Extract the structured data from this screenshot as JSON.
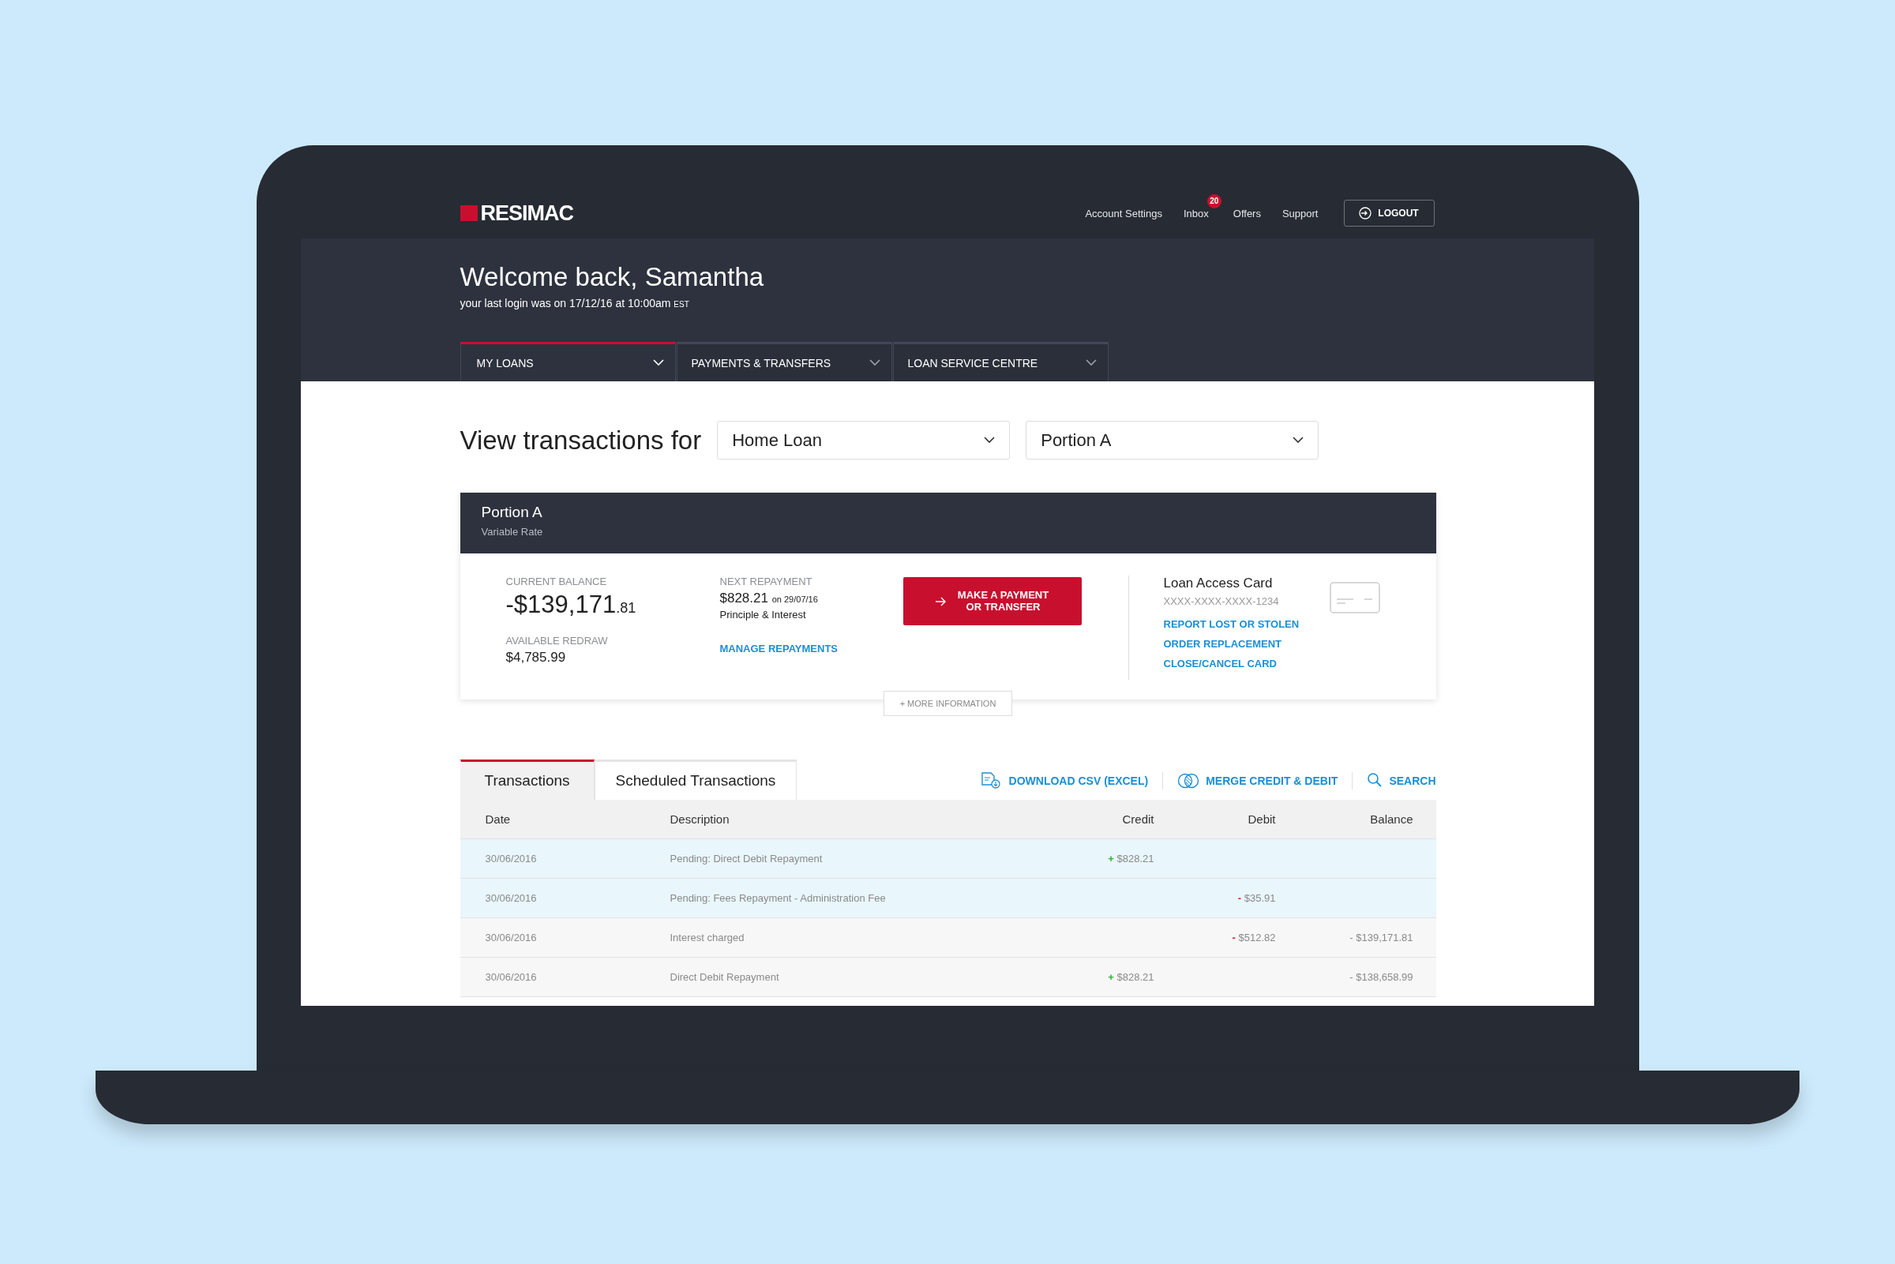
{
  "header": {
    "logo": "RESIMAC",
    "links": [
      {
        "label": "Account Settings"
      },
      {
        "label": "Inbox",
        "badge": "20"
      },
      {
        "label": "Offers"
      },
      {
        "label": "Support"
      }
    ],
    "logout": "LOGOUT"
  },
  "welcome": {
    "greeting": "Welcome back,",
    "name": "Samantha",
    "last_login": "your last login was on 17/12/16 at 10:00am",
    "timezone": "EST"
  },
  "nav_tabs": [
    {
      "label": "MY LOANS",
      "selected": true
    },
    {
      "label": "PAYMENTS & TRANSFERS",
      "selected": false
    },
    {
      "label": "LOAN SERVICE CENTRE",
      "selected": false
    }
  ],
  "filter": {
    "label": "View transactions for",
    "selects": [
      {
        "value": "Home Loan"
      },
      {
        "value": "Portion A"
      }
    ]
  },
  "loan_card": {
    "title": "Portion A",
    "subtitle": "Variable Rate",
    "current_balance": {
      "label": "CURRENT BALANCE",
      "amount": "-$139,171",
      "cents": ".81"
    },
    "available_redraw": {
      "label": "AVAILABLE REDRAW",
      "amount": "$4,785.99"
    },
    "next_repayment": {
      "label": "NEXT REPAYMENT",
      "amount": "$828.21",
      "date": "on 29/07/16",
      "type": "Principle & Interest",
      "link": "MANAGE REPAYMENTS"
    },
    "payment_button": [
      "MAKE A PAYMENT",
      "OR TRANSFER"
    ],
    "access_card": {
      "title": "Loan Access Card",
      "number": "XXXX-XXXX-XXXX-1234",
      "links": [
        "REPORT LOST OR STOLEN",
        "ORDER REPLACEMENT",
        "CLOSE/CANCEL CARD"
      ]
    },
    "more_info": "+ MORE INFORMATION"
  },
  "transactions": {
    "tabs": [
      {
        "label": "Transactions",
        "selected": true
      },
      {
        "label": "Scheduled Transactions",
        "selected": false
      }
    ],
    "actions": [
      {
        "kind": "download",
        "label": "DOWNLOAD CSV (EXCEL)"
      },
      {
        "kind": "merge",
        "label": "MERGE CREDIT & DEBIT"
      },
      {
        "kind": "search",
        "label": "SEARCH"
      }
    ],
    "columns": [
      "Date",
      "Description",
      "Credit",
      "Debit",
      "Balance"
    ],
    "rows": [
      {
        "date": "30/06/2016",
        "description": "Pending: Direct Debit Repayment",
        "credit": {
          "sign": "+",
          "amount": "$828.21"
        },
        "pending": true
      },
      {
        "date": "30/06/2016",
        "description": "Pending: Fees Repayment  - Administration Fee",
        "debit": {
          "sign": "-",
          "amount": "$35.91"
        },
        "pending": true
      },
      {
        "date": "30/06/2016",
        "description": "Interest charged",
        "debit": {
          "sign": "-",
          "amount": "$512.82"
        },
        "balance": "- $139,171.81",
        "pending": false
      },
      {
        "date": "30/06/2016",
        "description": "Direct Debit Repayment",
        "credit": {
          "sign": "+",
          "amount": "$828.21"
        },
        "balance": "- $138,658.99",
        "pending": false
      }
    ]
  }
}
